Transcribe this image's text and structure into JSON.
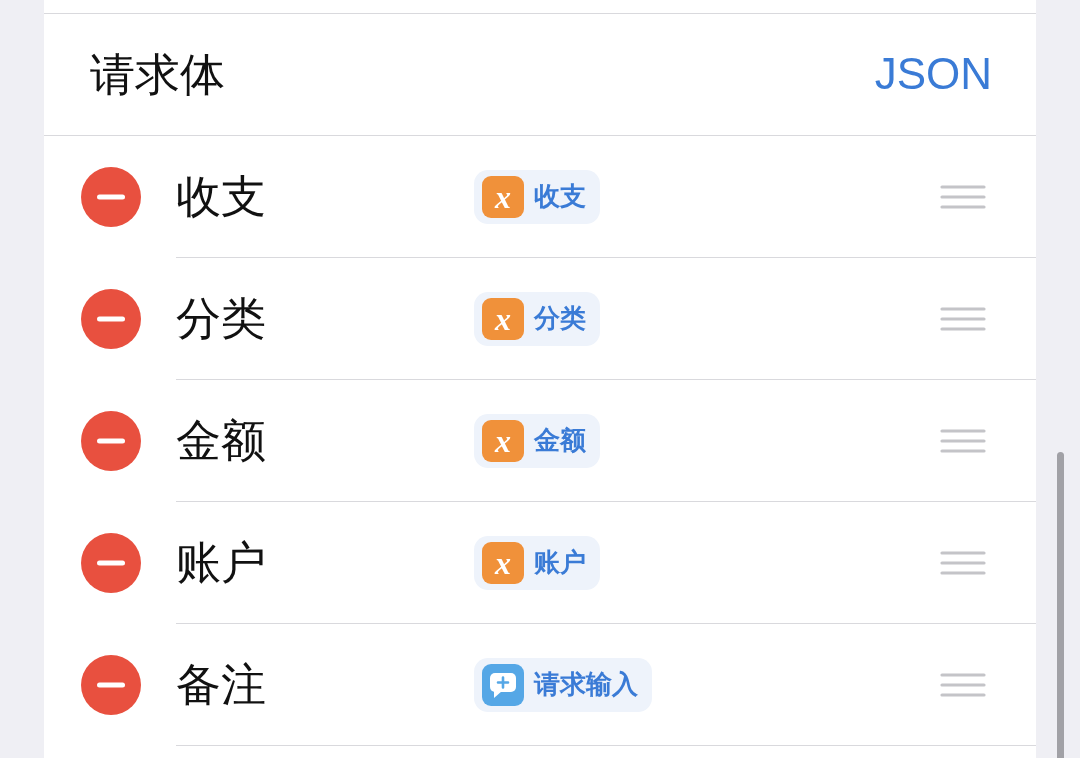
{
  "section": {
    "title": "请求体",
    "format": "JSON"
  },
  "fields": [
    {
      "name": "收支",
      "value": {
        "kind": "variable",
        "glyph": "x",
        "label": "收支"
      }
    },
    {
      "name": "分类",
      "value": {
        "kind": "variable",
        "glyph": "x",
        "label": "分类"
      }
    },
    {
      "name": "金额",
      "value": {
        "kind": "variable",
        "glyph": "x",
        "label": "金额"
      }
    },
    {
      "name": "账户",
      "value": {
        "kind": "variable",
        "glyph": "x",
        "label": "账户"
      }
    },
    {
      "name": "备注",
      "value": {
        "kind": "ask",
        "label": "请求输入"
      }
    }
  ]
}
